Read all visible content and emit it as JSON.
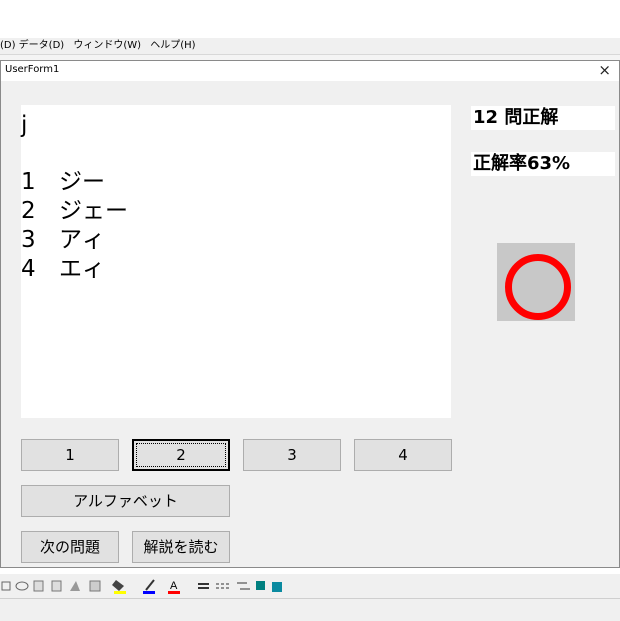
{
  "menu": {
    "items": [
      "(D) データ(D)",
      "ウィンドウ(W)",
      "ヘルプ(H)"
    ]
  },
  "window": {
    "title": "UserForm1",
    "close_glyph": "×"
  },
  "question": {
    "prompt": "j",
    "choices": [
      {
        "num": "1",
        "text": "ジー"
      },
      {
        "num": "2",
        "text": "ジェー"
      },
      {
        "num": "3",
        "text": "アィ"
      },
      {
        "num": "4",
        "text": "エィ"
      }
    ]
  },
  "stats": {
    "correct_count": "12 問正解",
    "accuracy": "正解率63%"
  },
  "mark": {
    "result_icon": "correct-circle",
    "color": "#ff0000"
  },
  "buttons": {
    "answer1": "1",
    "answer2": "2",
    "answer3": "3",
    "answer4": "4",
    "alphabet": "アルファベット",
    "next": "次の問題",
    "explain": "解説を読む"
  }
}
